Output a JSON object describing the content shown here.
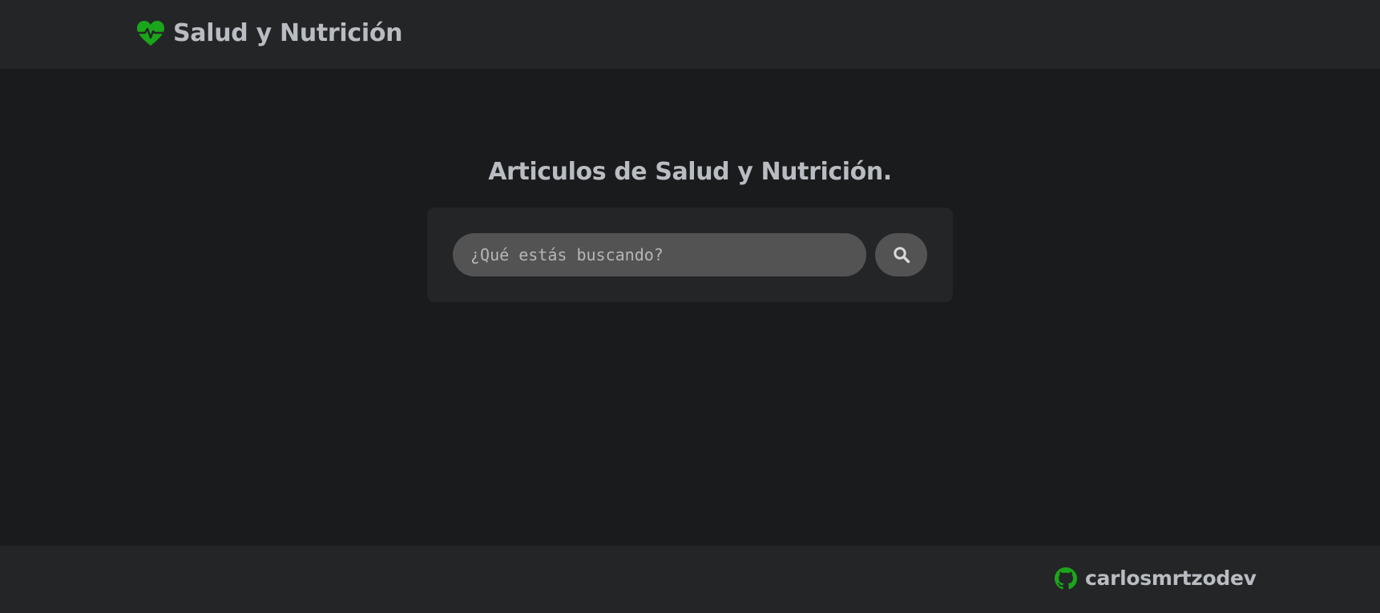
{
  "header": {
    "brand_icon": "heart-pulse-icon",
    "title": "Salud y Nutrición"
  },
  "main": {
    "title": "Articulos de Salud y Nutrición.",
    "search": {
      "value": "",
      "placeholder": "¿Qué estás buscando?",
      "button_icon": "search-icon"
    }
  },
  "footer": {
    "icon": "github-icon",
    "username": "carlosmrtzodev"
  },
  "colors": {
    "accent": "#1aa51a",
    "text": "#b9bcc0",
    "bar_background": "#242527",
    "page_background": "#1a1b1d",
    "input_background": "#535353"
  }
}
